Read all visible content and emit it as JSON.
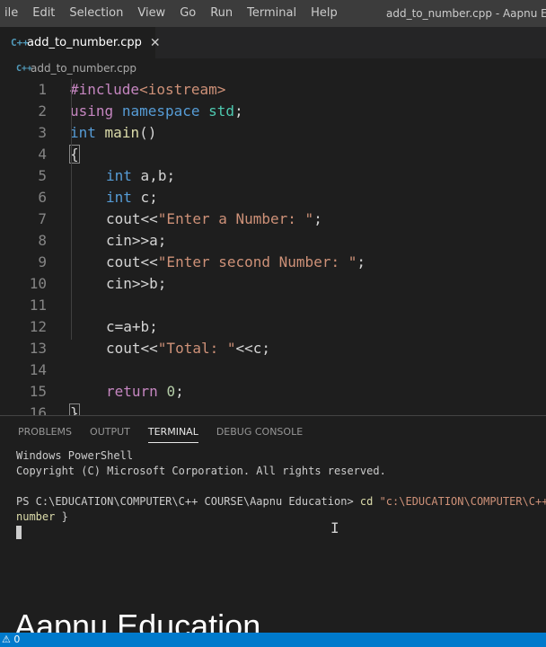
{
  "menu": {
    "items": [
      "ile",
      "Edit",
      "Selection",
      "View",
      "Go",
      "Run",
      "Terminal",
      "Help"
    ]
  },
  "window": {
    "title": "add_to_number.cpp - Aapnu Educ"
  },
  "tab": {
    "icon": "C++",
    "label": "add_to_number.cpp",
    "close": "✕"
  },
  "breadcrumb": {
    "icon": "C++",
    "label": "add_to_number.cpp"
  },
  "editor": {
    "line_numbers": [
      "1",
      "2",
      "3",
      "4",
      "5",
      "6",
      "7",
      "8",
      "9",
      "10",
      "11",
      "12",
      "13",
      "14",
      "15",
      "16"
    ],
    "code": {
      "l1_dir": "#include",
      "l1_inc": "<iostream>",
      "l2_kw1": "using",
      "l2_kw2": "namespace",
      "l2_ns": "std",
      "l2_semi": ";",
      "l3_type": "int",
      "l3_fn": "main",
      "l3_paren": "()",
      "l4_brace": "{",
      "l5_type": "int",
      "l5_rest": "a,b;",
      "l6_type": "int",
      "l6_rest": "c;",
      "l7_pre": "cout<<",
      "l7_str": "\"Enter a Number: \"",
      "l7_post": ";",
      "l8": "cin>>a;",
      "l9_pre": "cout<<",
      "l9_str": "\"Enter second Number: \"",
      "l9_post": ";",
      "l10": "cin>>b;",
      "l12": "c=a+b;",
      "l13_pre": "cout<<",
      "l13_str": "\"Total: \"",
      "l13_post": "<<c;",
      "l15_kw": "return",
      "l15_num": "0",
      "l15_semi": ";",
      "l16_brace": "}"
    }
  },
  "panel": {
    "tabs": [
      "PROBLEMS",
      "OUTPUT",
      "TERMINAL",
      "DEBUG CONSOLE"
    ],
    "active_tab": "TERMINAL",
    "terminal": {
      "line1": "Windows PowerShell",
      "line2": "Copyright (C) Microsoft Corporation. All rights reserved.",
      "prompt": "PS C:\\EDUCATION\\COMPUTER\\C++ COURSE\\Aapnu Education> ",
      "cmd": "cd",
      "arg": " \"c:\\EDUCATION\\COMPUTER\\C++ CO",
      "cont_arg": "number",
      "cont_rest": " }"
    }
  },
  "watermark": {
    "text": "Aapnu Education"
  },
  "status": {
    "left": "⚠ 0"
  },
  "colors": {
    "accent": "#007acc",
    "editor_bg": "#1e1e1e",
    "keyword": "#569cd6",
    "string": "#ce9178"
  }
}
